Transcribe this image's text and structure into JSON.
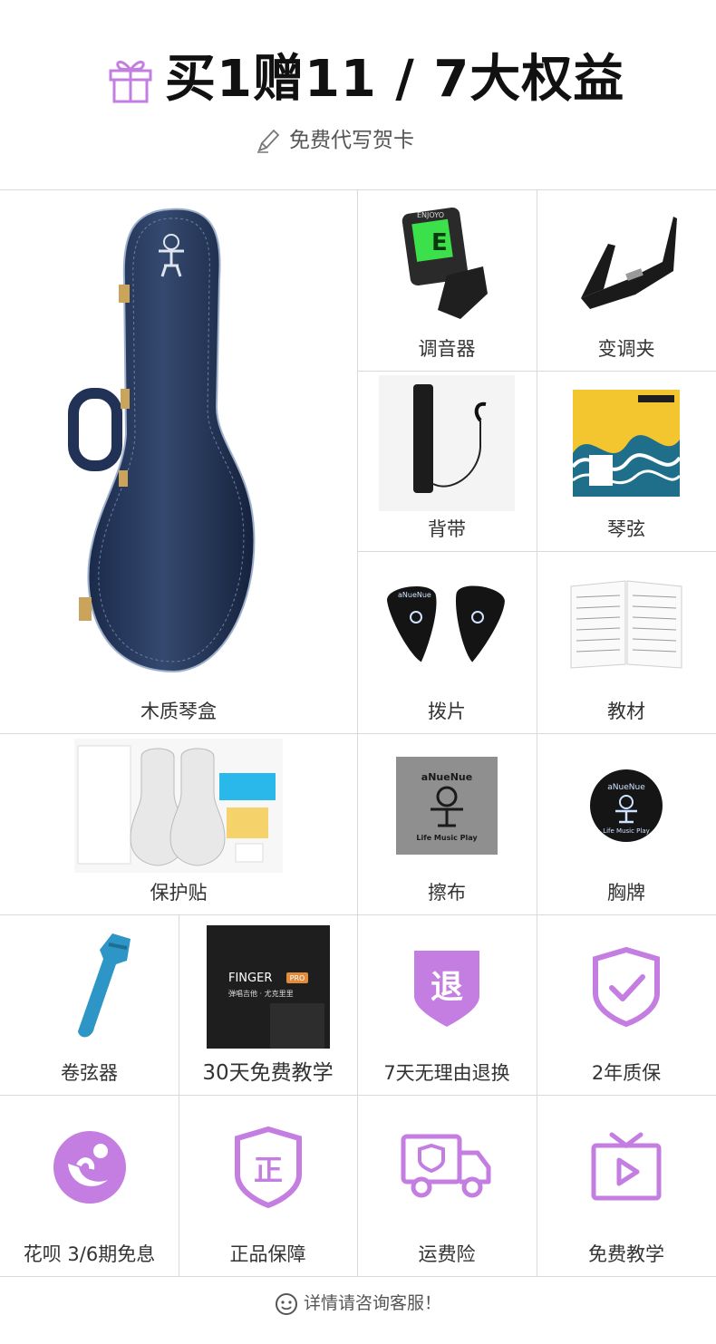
{
  "header": {
    "title": "买1赠11 / 7大权益",
    "subtitle": "免费代写贺卡"
  },
  "accent_color": "#c47de0",
  "items": {
    "case": "木质琴盒",
    "tuner": "调音器",
    "capo": "变调夹",
    "strap": "背带",
    "strings": "琴弦",
    "picks": "拨片",
    "book": "教材",
    "protector": "保护贴",
    "cloth": "擦布",
    "badge": "胸牌",
    "winder": "卷弦器",
    "course": "30天免费教学",
    "return": "7天无理由退换",
    "warranty": "2年质保",
    "huabei": "花呗 3/6期免息",
    "genuine": "正品保障",
    "shipping": "运费险",
    "teaching": "免费教学"
  },
  "product_text": {
    "tuner_display": "E",
    "tuner_brand": "ENJOYO",
    "picks_brand": "aNueNue",
    "cloth_brand": "aNueNue",
    "cloth_slogan": "Life Music Play",
    "badge_brand": "aNueNue",
    "badge_slogan": "Life Music Play",
    "course_brand": "FINGER",
    "course_pro": "PRO",
    "course_line": "弹唱吉他 · 尤克里里",
    "return_glyph": "退",
    "genuine_glyph": "正"
  },
  "footer": {
    "text": "详情请咨询客服！"
  }
}
